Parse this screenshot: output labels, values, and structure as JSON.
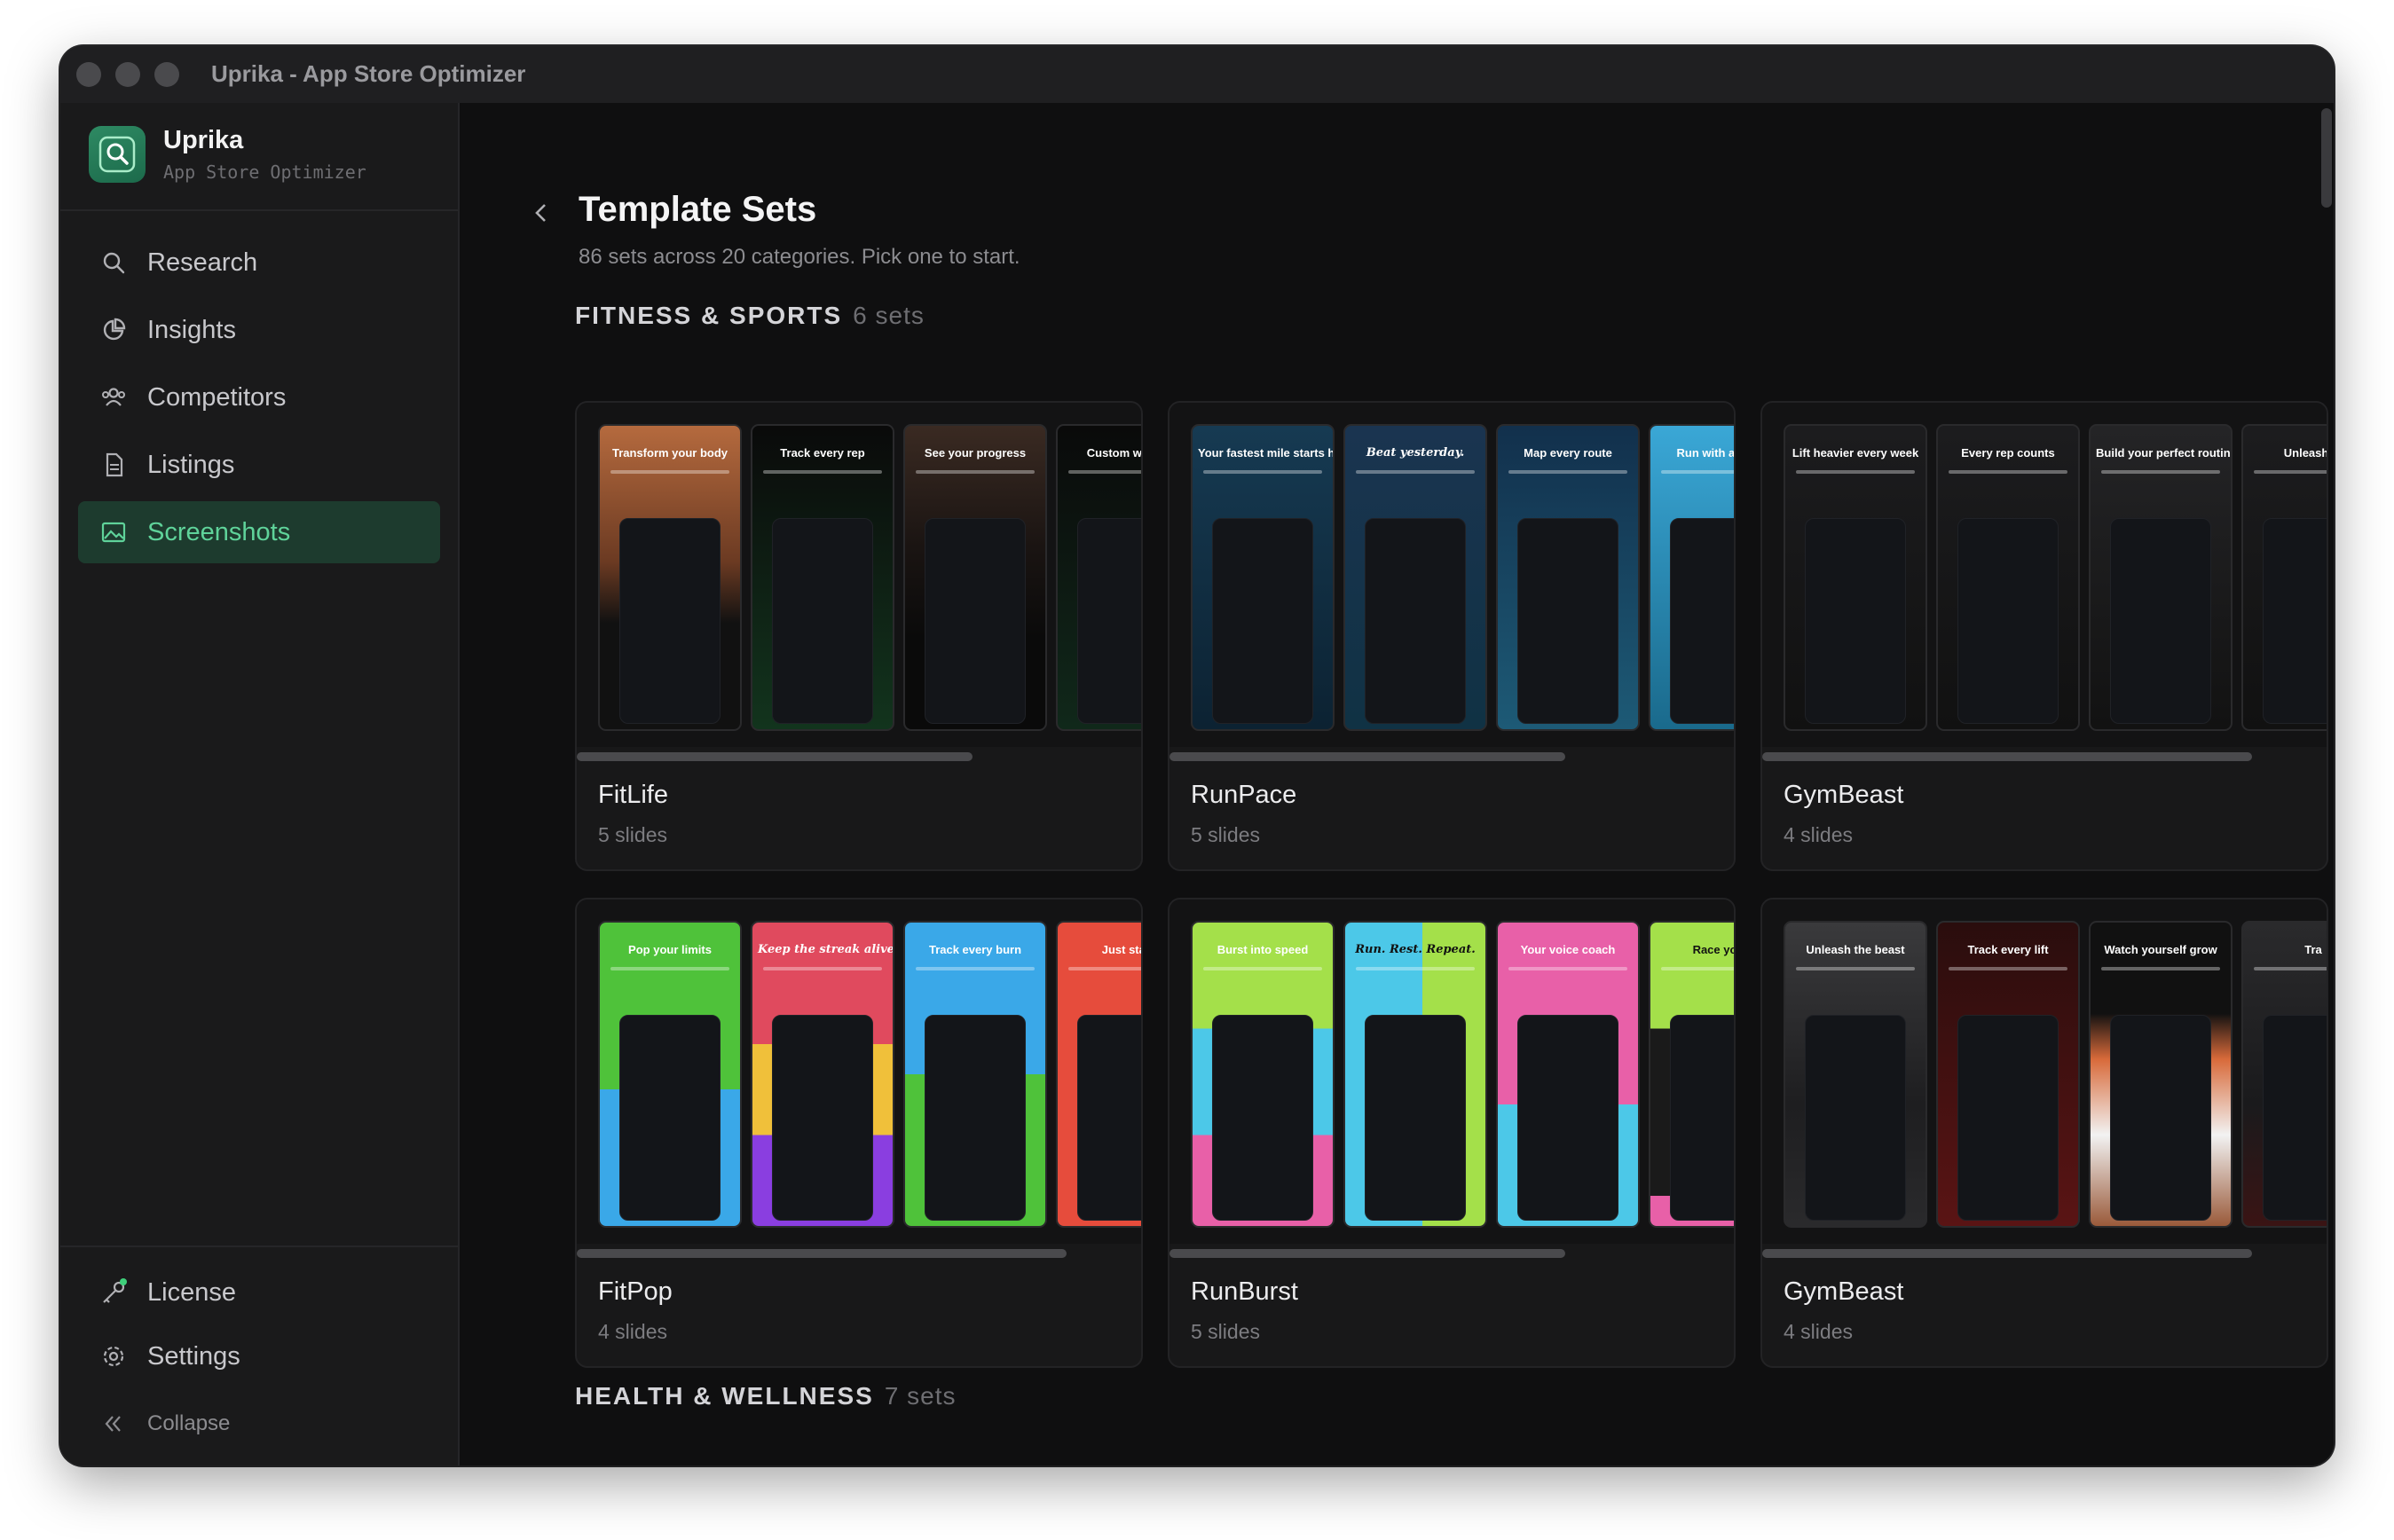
{
  "window": {
    "title": "Uprika - App Store Optimizer"
  },
  "brand": {
    "name": "Uprika",
    "subtitle": "App Store Optimizer"
  },
  "nav": [
    {
      "label": "Research",
      "icon": "search-icon"
    },
    {
      "label": "Insights",
      "icon": "pie-chart-icon"
    },
    {
      "label": "Competitors",
      "icon": "users-icon"
    },
    {
      "label": "Listings",
      "icon": "document-icon"
    },
    {
      "label": "Screenshots",
      "icon": "image-icon",
      "active": true
    }
  ],
  "footer_nav": {
    "license": "License",
    "settings": "Settings",
    "collapse": "Collapse"
  },
  "page": {
    "title": "Template Sets",
    "subtitle": "86 sets across 20 categories. Pick one to start."
  },
  "categories": [
    {
      "name": "FITNESS & SPORTS",
      "count": "6 sets",
      "sets": [
        {
          "name": "FitLife",
          "slides": "5 slides",
          "captions": [
            "Transform your body",
            "Track every rep",
            "See your progress",
            "Custom w plan"
          ]
        },
        {
          "name": "RunPace",
          "slides": "5 slides",
          "captions": [
            "Your fastest mile starts here",
            "Beat yesterday.",
            "Map every route",
            "Run with anywh"
          ]
        },
        {
          "name": "GymBeast",
          "slides": "4 slides",
          "captions": [
            "Lift heavier every week",
            "Every rep counts",
            "Build your perfect routine",
            "Unleash th"
          ]
        },
        {
          "name": "FitPop",
          "slides": "4 slides",
          "captions": [
            "Pop your limits",
            "Keep the streak alive.",
            "Track every burn",
            "Just start"
          ]
        },
        {
          "name": "RunBurst",
          "slides": "5 slides",
          "captions": [
            "Burst into speed",
            "Run. Rest. Repeat.",
            "Your voice coach",
            "Race your"
          ]
        },
        {
          "name": "GymBeast",
          "slides": "4 slides",
          "captions": [
            "Unleash the beast",
            "Track every lift",
            "Watch yourself grow",
            "Tra"
          ]
        }
      ]
    },
    {
      "name": "HEALTH & WELLNESS",
      "count": "7 sets"
    }
  ]
}
